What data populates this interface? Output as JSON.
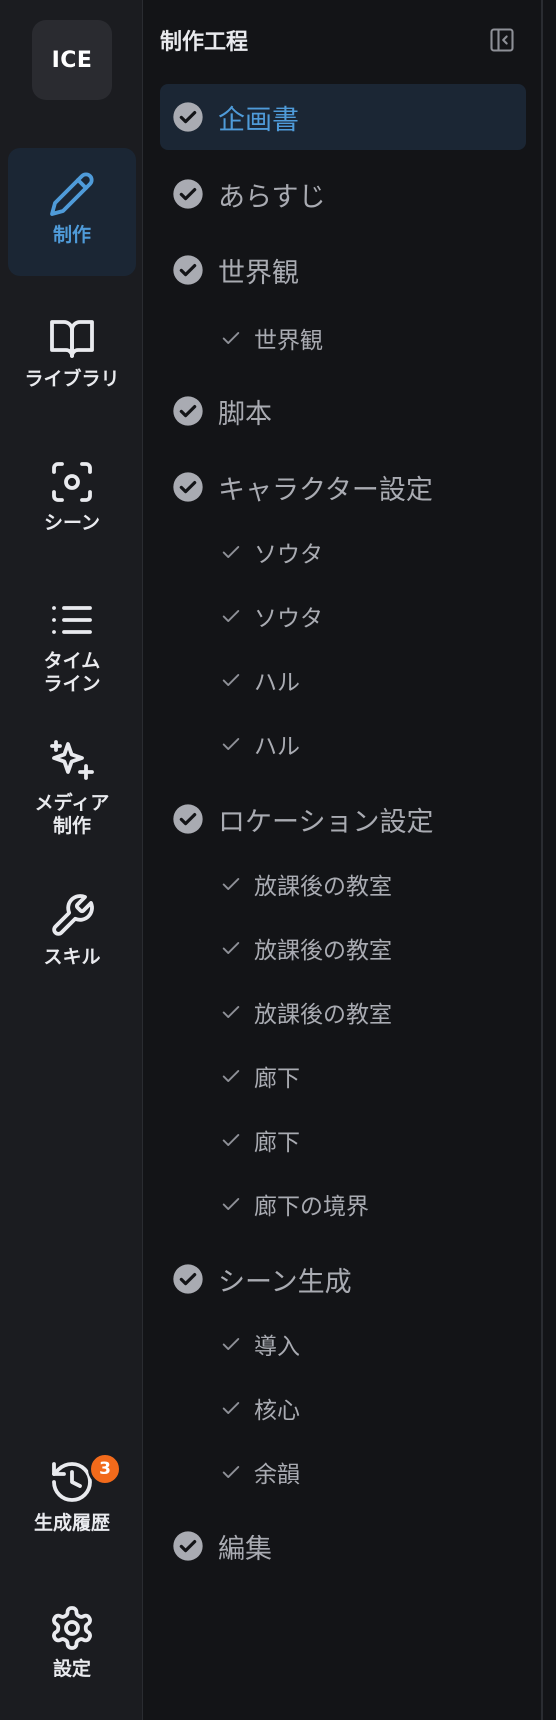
{
  "rail": {
    "logo": "ICE",
    "nav": [
      {
        "label": "制作",
        "icon": "pencil-icon"
      },
      {
        "label": "ライブラリ",
        "icon": "book-open-icon"
      },
      {
        "label": "シーン",
        "icon": "scan-focus-icon"
      },
      {
        "label": "タイム\nライン",
        "icon": "list-icon"
      },
      {
        "label": "メディア\n制作",
        "icon": "sparkles-icon"
      },
      {
        "label": "スキル",
        "icon": "wrench-icon"
      }
    ],
    "history": {
      "label": "生成履歴",
      "badge": "3",
      "icon": "history-icon"
    },
    "settings": {
      "label": "設定",
      "icon": "gear-icon"
    }
  },
  "panel": {
    "title": "制作工程",
    "steps": [
      {
        "label": "企画書",
        "active": true,
        "subs": []
      },
      {
        "label": "あらすじ",
        "subs": []
      },
      {
        "label": "世界観",
        "subs": [
          "世界観"
        ]
      },
      {
        "label": "脚本",
        "subs": []
      },
      {
        "label": "キャラクター設定",
        "subs": [
          "ソウタ",
          "ソウタ",
          "ハル",
          "ハル"
        ]
      },
      {
        "label": "ロケーション設定",
        "subs": [
          "放課後の教室",
          "放課後の教室",
          "放課後の教室",
          "廊下",
          "廊下",
          "廊下の境界"
        ]
      },
      {
        "label": "シーン生成",
        "subs": [
          "導入",
          "核心",
          "余韻"
        ]
      },
      {
        "label": "編集",
        "subs": []
      }
    ]
  },
  "colors": {
    "accent": "#4f9bd9",
    "badge": "#f26a1b",
    "rail_bg": "#1b1c20",
    "panel_bg": "#131417"
  }
}
